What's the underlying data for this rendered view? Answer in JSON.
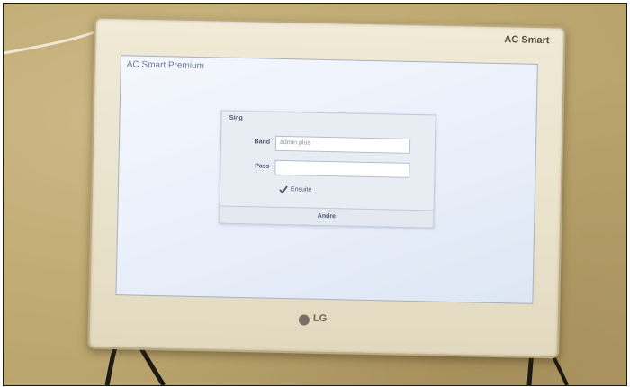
{
  "monitor": {
    "brand_top": "AC Smart",
    "logo_text": "LG",
    "frame_color": "#efe8d3"
  },
  "screen": {
    "app_title": "AC Smart Premium",
    "corner_text": "",
    "dialog": {
      "title": "Sing",
      "fields": [
        {
          "label": "Band",
          "value": "admin plus"
        },
        {
          "label": "Pass",
          "value": ""
        }
      ],
      "checkbox": {
        "label": "Ensuite",
        "checked": true
      },
      "button_label": "Andre"
    }
  },
  "colors": {
    "wall": "#c2ad76",
    "screen_bg": "#edf1fa",
    "dialog_bg": "#e8ecf3"
  }
}
